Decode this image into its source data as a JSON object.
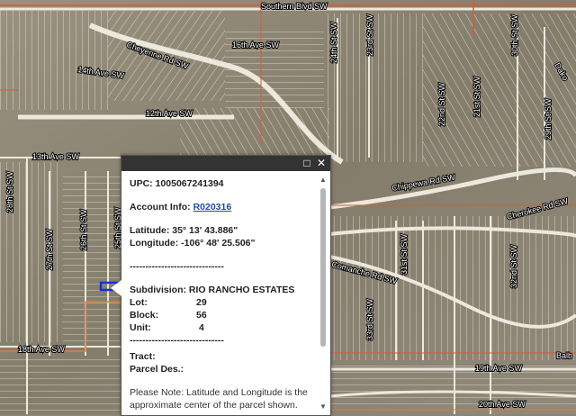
{
  "map": {
    "streets": {
      "southern_blvd": "Southern Blvd SW",
      "cheyenne_rd": "Cheyenne Rd SW",
      "ave_16": "16th Ave SW",
      "ave_14": "14th Ave SW",
      "ave_12": "12th Ave SW",
      "ave_13": "13th Ave SW",
      "chippewa_rd": "Chippewa Rd SW",
      "cherokee_rd": "Cherokee Rd SW",
      "comanche_rd": "Comanche Rd SW",
      "ave_18": "18th Ave SW",
      "ave_19": "19th Ave SW",
      "ave_20": "20th Ave SW",
      "st_28": "28th St SW",
      "st_27": "27th St SW",
      "st_26": "26th St SW",
      "st_25": "25th St SW",
      "st_24": "24th St SW",
      "st_23": "23rd St SW",
      "st_22": "22nd St SW",
      "st_21": "21st St SW",
      "st_29": "29th St SW",
      "st_30": "30th St SW",
      "st_31": "31st St SW",
      "st_32": "32nd St SW",
      "st_33": "33rd St SW",
      "dakota": "Dako",
      "balboa": "Balb"
    },
    "colors": {
      "road_red": "#d9583c",
      "road_orange": "#e07a3a",
      "parcel_line": "#ece8dc",
      "selection": "#1530d8"
    }
  },
  "popup": {
    "upc_label": "UPC:",
    "upc_value": "1005067241394",
    "account_label": "Account Info:",
    "account_value": "R020316",
    "lat_label": "Latitude:",
    "lat_value": "35° 13' 43.886\"",
    "lon_label": "Longitude:",
    "lon_value": "-106° 48' 25.506\"",
    "divider": "------------------------------",
    "subdivision_label": "Subdivision:",
    "subdivision_value": "RIO RANCHO ESTATES",
    "lot_label": "Lot:",
    "lot_value": "29",
    "block_label": "Block:",
    "block_value": "56",
    "unit_label": "Unit:",
    "unit_value": "4",
    "divider2": "------------------------------",
    "tract_label": "Tract:",
    "parcel_label": "Parcel Des.:",
    "note": "Please Note: Latitude and Longitude is the approximate center of the parcel shown.",
    "maximize_icon": "□",
    "close_icon": "✕"
  }
}
